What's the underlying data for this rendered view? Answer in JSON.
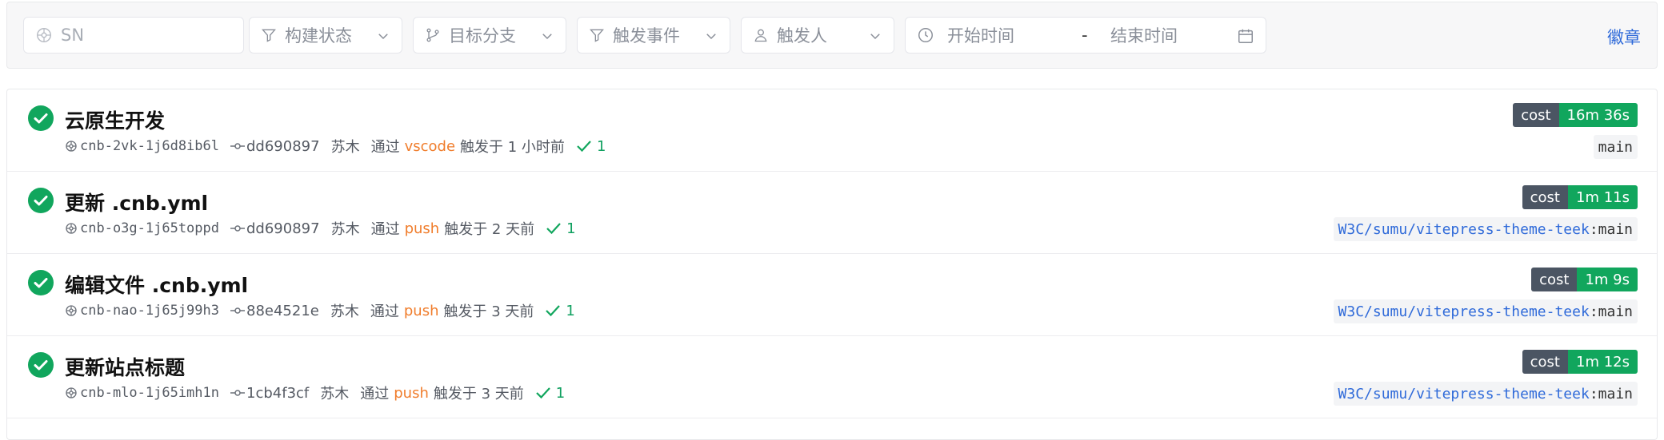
{
  "filters": {
    "sn_placeholder": "SN",
    "build_status": "构建状态",
    "target_branch": "目标分支",
    "trigger_event": "触发事件",
    "trigger_user": "触发人",
    "start_time": "开始时间",
    "range_sep": "-",
    "end_time": "结束时间",
    "badge_link": "徽章"
  },
  "builds": [
    {
      "title": "云原生开发",
      "sn": "cnb-2vk-1j6d8ib6l",
      "commit": "dd690897",
      "user": "苏木",
      "via": "通过",
      "trigger": "vscode",
      "time": "触发于 1 小时前",
      "passed": "1",
      "cost_label": "cost",
      "cost": "16m 36s",
      "repo": "",
      "branch": "main"
    },
    {
      "title": "更新 .cnb.yml",
      "sn": "cnb-o3g-1j65toppd",
      "commit": "dd690897",
      "user": "苏木",
      "via": "通过",
      "trigger": "push",
      "time": "触发于 2 天前",
      "passed": "1",
      "cost_label": "cost",
      "cost": "1m 11s",
      "repo": "W3C/sumu/vitepress-theme-teek",
      "branch": ":main"
    },
    {
      "title": "编辑文件 .cnb.yml",
      "sn": "cnb-nao-1j65j99h3",
      "commit": "88e4521e",
      "user": "苏木",
      "via": "通过",
      "trigger": "push",
      "time": "触发于 3 天前",
      "passed": "1",
      "cost_label": "cost",
      "cost": "1m 9s",
      "repo": "W3C/sumu/vitepress-theme-teek",
      "branch": ":main"
    },
    {
      "title": "更新站点标题",
      "sn": "cnb-mlo-1j65imh1n",
      "commit": "1cb4f3cf",
      "user": "苏木",
      "via": "通过",
      "trigger": "push",
      "time": "触发于 3 天前",
      "passed": "1",
      "cost_label": "cost",
      "cost": "1m 12s",
      "repo": "W3C/sumu/vitepress-theme-teek",
      "branch": ":main"
    }
  ],
  "colors": {
    "success": "#11a65d",
    "trigger": "#f07d2c",
    "link": "#2f6ad9"
  }
}
